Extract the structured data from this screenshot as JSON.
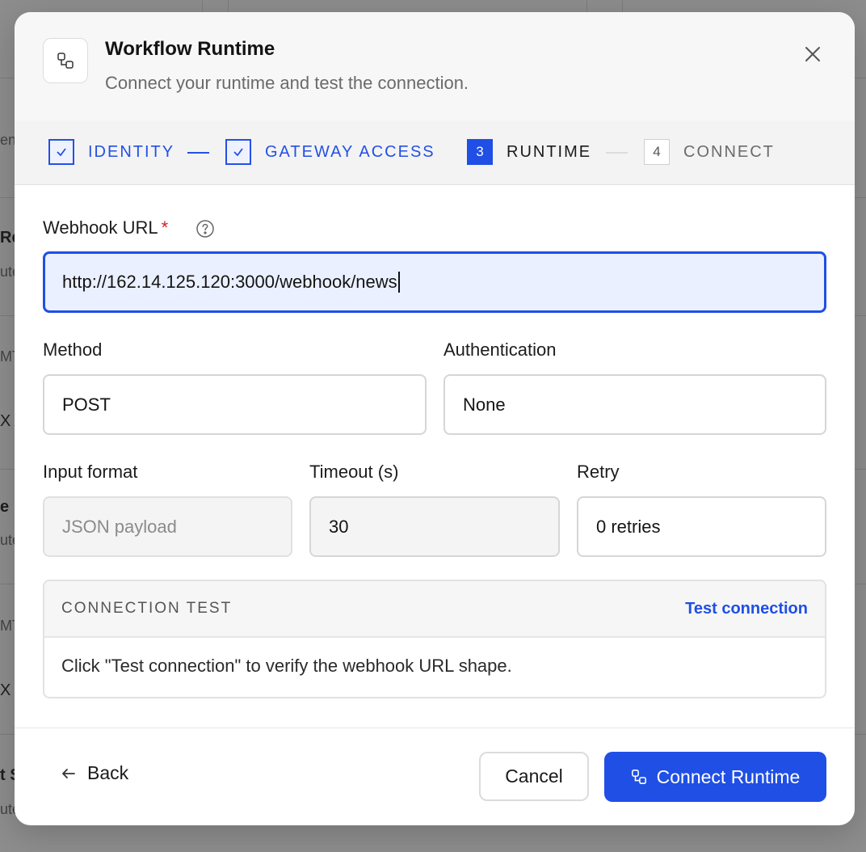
{
  "background": {
    "fragments": [
      "ent",
      "Re",
      "ute",
      "MT",
      "X",
      "e",
      "ute",
      "MT",
      "X",
      "t S",
      "ute"
    ]
  },
  "modal": {
    "title": "Workflow Runtime",
    "subtitle": "Connect your runtime and test the connection.",
    "header_icon": "workflow-icon",
    "close_icon": "close-icon"
  },
  "stepper": {
    "steps": [
      {
        "marker": "",
        "label": "IDENTITY",
        "state": "done"
      },
      {
        "marker": "",
        "label": "GATEWAY ACCESS",
        "state": "done"
      },
      {
        "marker": "3",
        "label": "RUNTIME",
        "state": "current"
      },
      {
        "marker": "4",
        "label": "CONNECT",
        "state": "pending"
      }
    ]
  },
  "form": {
    "webhook": {
      "label": "Webhook URL",
      "required_mark": "*",
      "value": "http://162.14.125.120:3000/webhook/news"
    },
    "method": {
      "label": "Method",
      "value": "POST"
    },
    "authentication": {
      "label": "Authentication",
      "value": "None"
    },
    "input_format": {
      "label": "Input format",
      "value": "JSON payload"
    },
    "timeout": {
      "label": "Timeout (s)",
      "value": "30"
    },
    "retry": {
      "label": "Retry",
      "value": "0 retries"
    }
  },
  "connection_test": {
    "title": "CONNECTION TEST",
    "action": "Test connection",
    "message": "Click \"Test connection\" to verify the webhook URL shape."
  },
  "footer": {
    "back_label": "Back",
    "cancel_label": "Cancel",
    "primary_label": "Connect Runtime"
  },
  "colors": {
    "accent": "#1f4fe5",
    "required": "#d02020",
    "overlay": "#8d8d8d"
  }
}
